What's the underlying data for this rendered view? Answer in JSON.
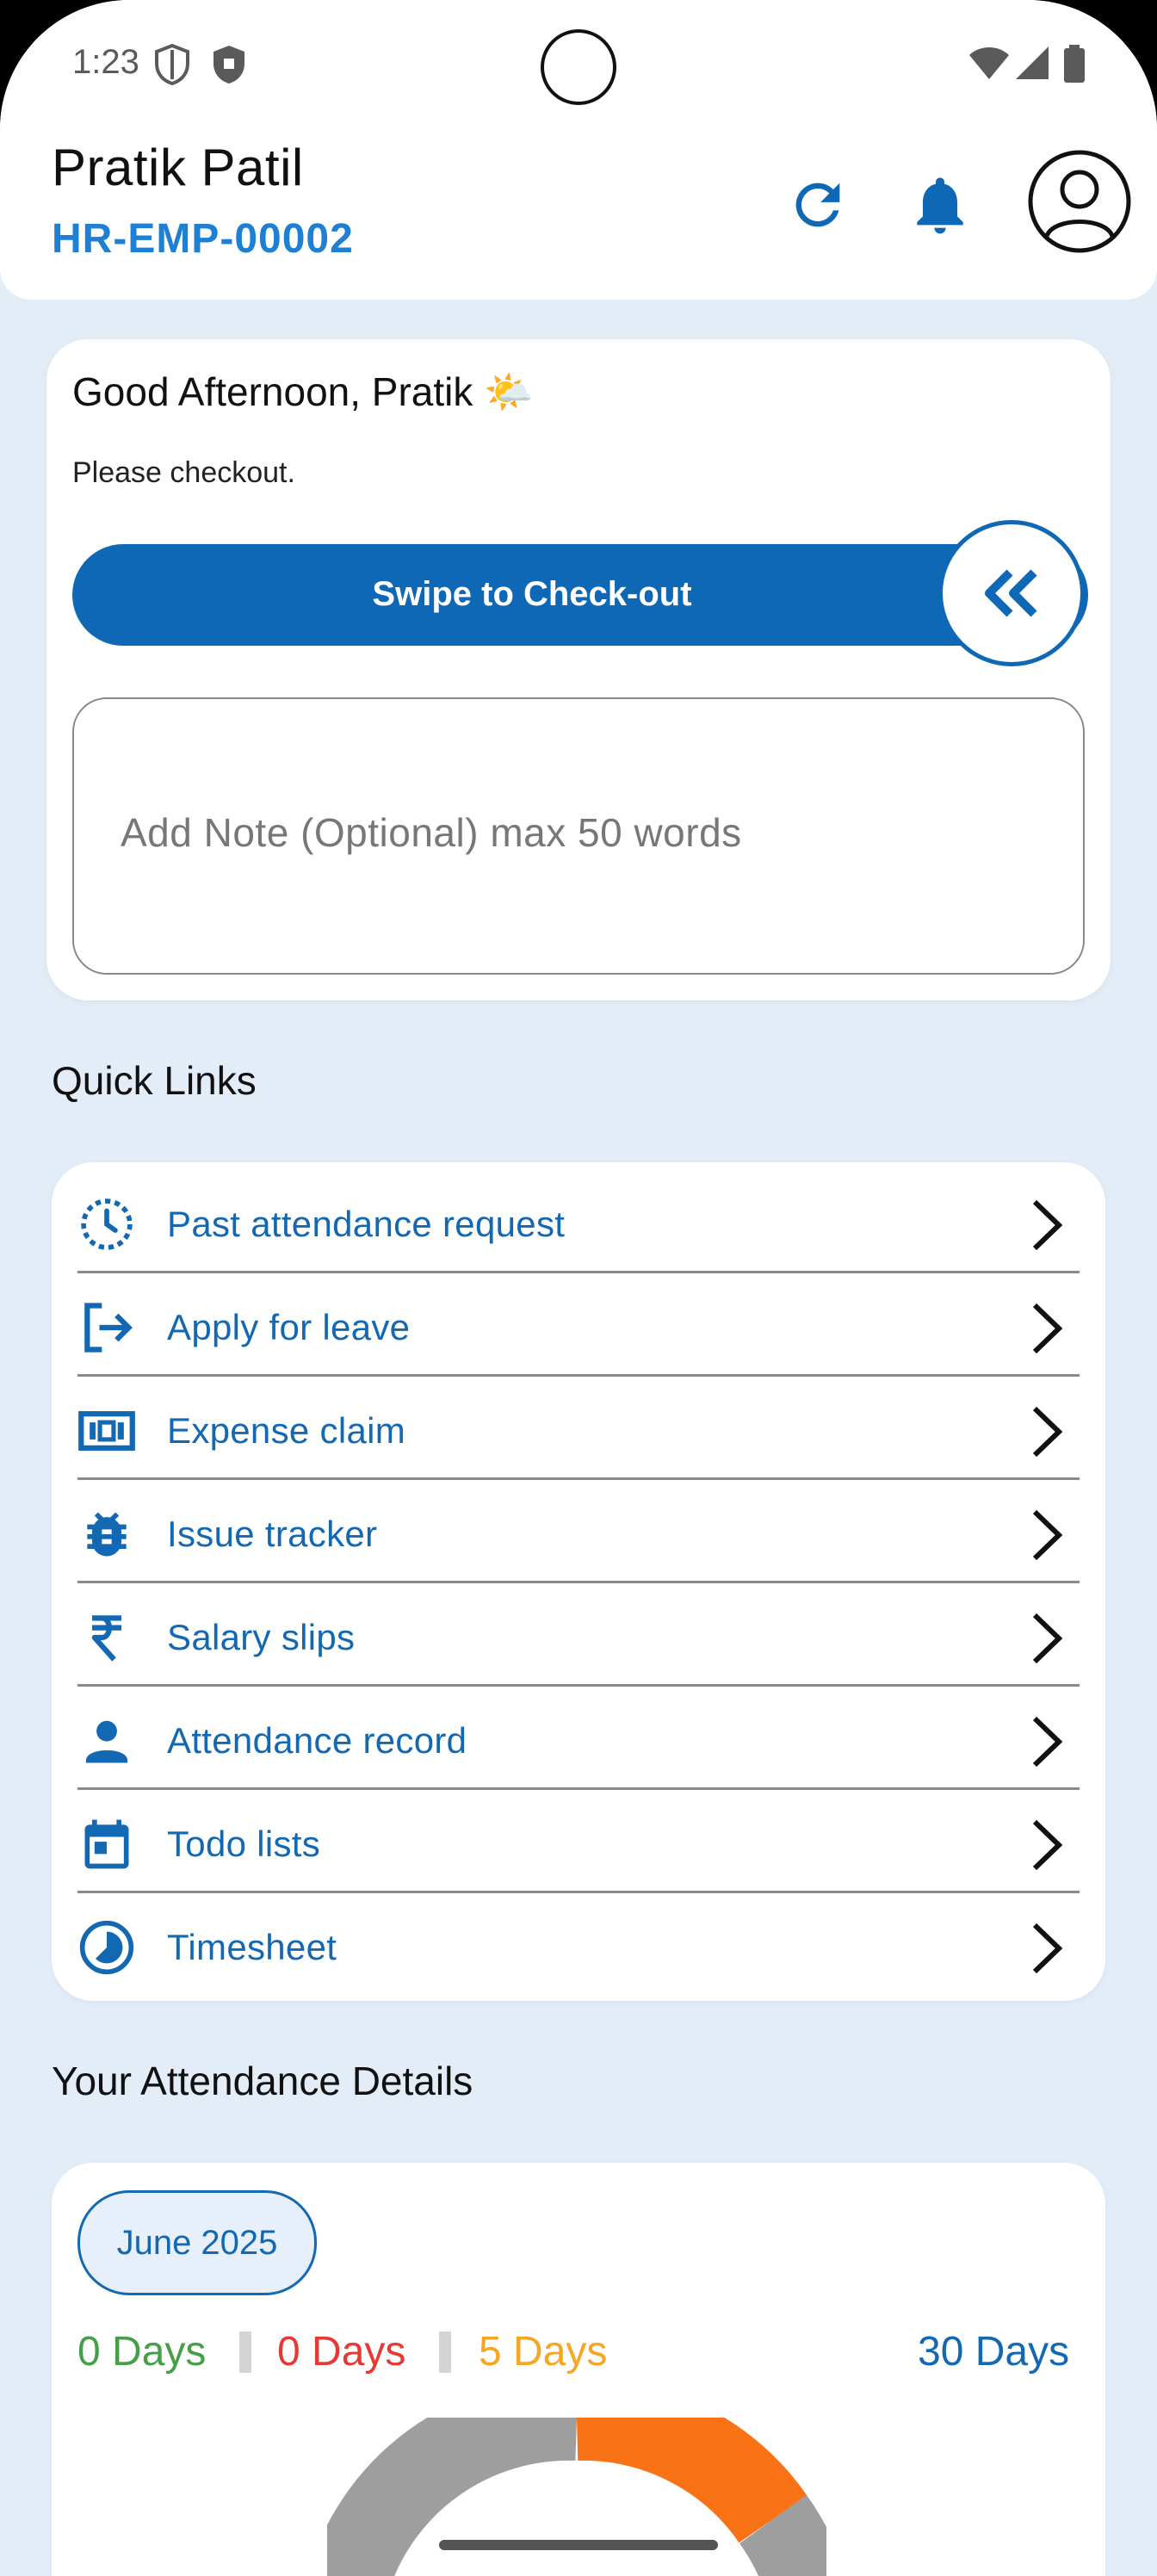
{
  "status_bar": {
    "time": "1:23"
  },
  "header": {
    "name": "Pratik Patil",
    "employee_id": "HR-EMP-00002",
    "icons": [
      "refresh-icon",
      "bell-icon",
      "profile-icon"
    ]
  },
  "greeting": {
    "title": "Good Afternoon, Pratik 🌤️",
    "subtitle": "Please checkout.",
    "swipe_label": "Swipe to Check-out",
    "note_placeholder": "Add Note (Optional) max 50 words"
  },
  "quick_links": {
    "title": "Quick Links",
    "items": [
      {
        "label": "Past attendance request",
        "icon": "clock-history-icon"
      },
      {
        "label": "Apply for leave",
        "icon": "logout-arrow-icon"
      },
      {
        "label": "Expense claim",
        "icon": "money-bill-icon"
      },
      {
        "label": "Issue tracker",
        "icon": "bug-icon"
      },
      {
        "label": "Salary slips",
        "icon": "rupee-icon"
      },
      {
        "label": "Attendance record",
        "icon": "person-icon"
      },
      {
        "label": "Todo lists",
        "icon": "calendar-icon"
      },
      {
        "label": "Timesheet",
        "icon": "timesheet-icon"
      }
    ]
  },
  "attendance": {
    "title": "Your Attendance Details",
    "month": "June 2025",
    "stats": [
      {
        "value": "0 Days",
        "color": "#43a047"
      },
      {
        "value": "0 Days",
        "color": "#e53935"
      },
      {
        "value": "5 Days",
        "color": "#f5a623"
      },
      {
        "value": "30 Days",
        "color": "#1368b3"
      }
    ]
  },
  "colors": {
    "primary": "#0f68b5",
    "link": "#1368b3",
    "background": "#e3edf7",
    "gauge_orange": "#f97316",
    "gauge_gray": "#9e9e9e"
  }
}
